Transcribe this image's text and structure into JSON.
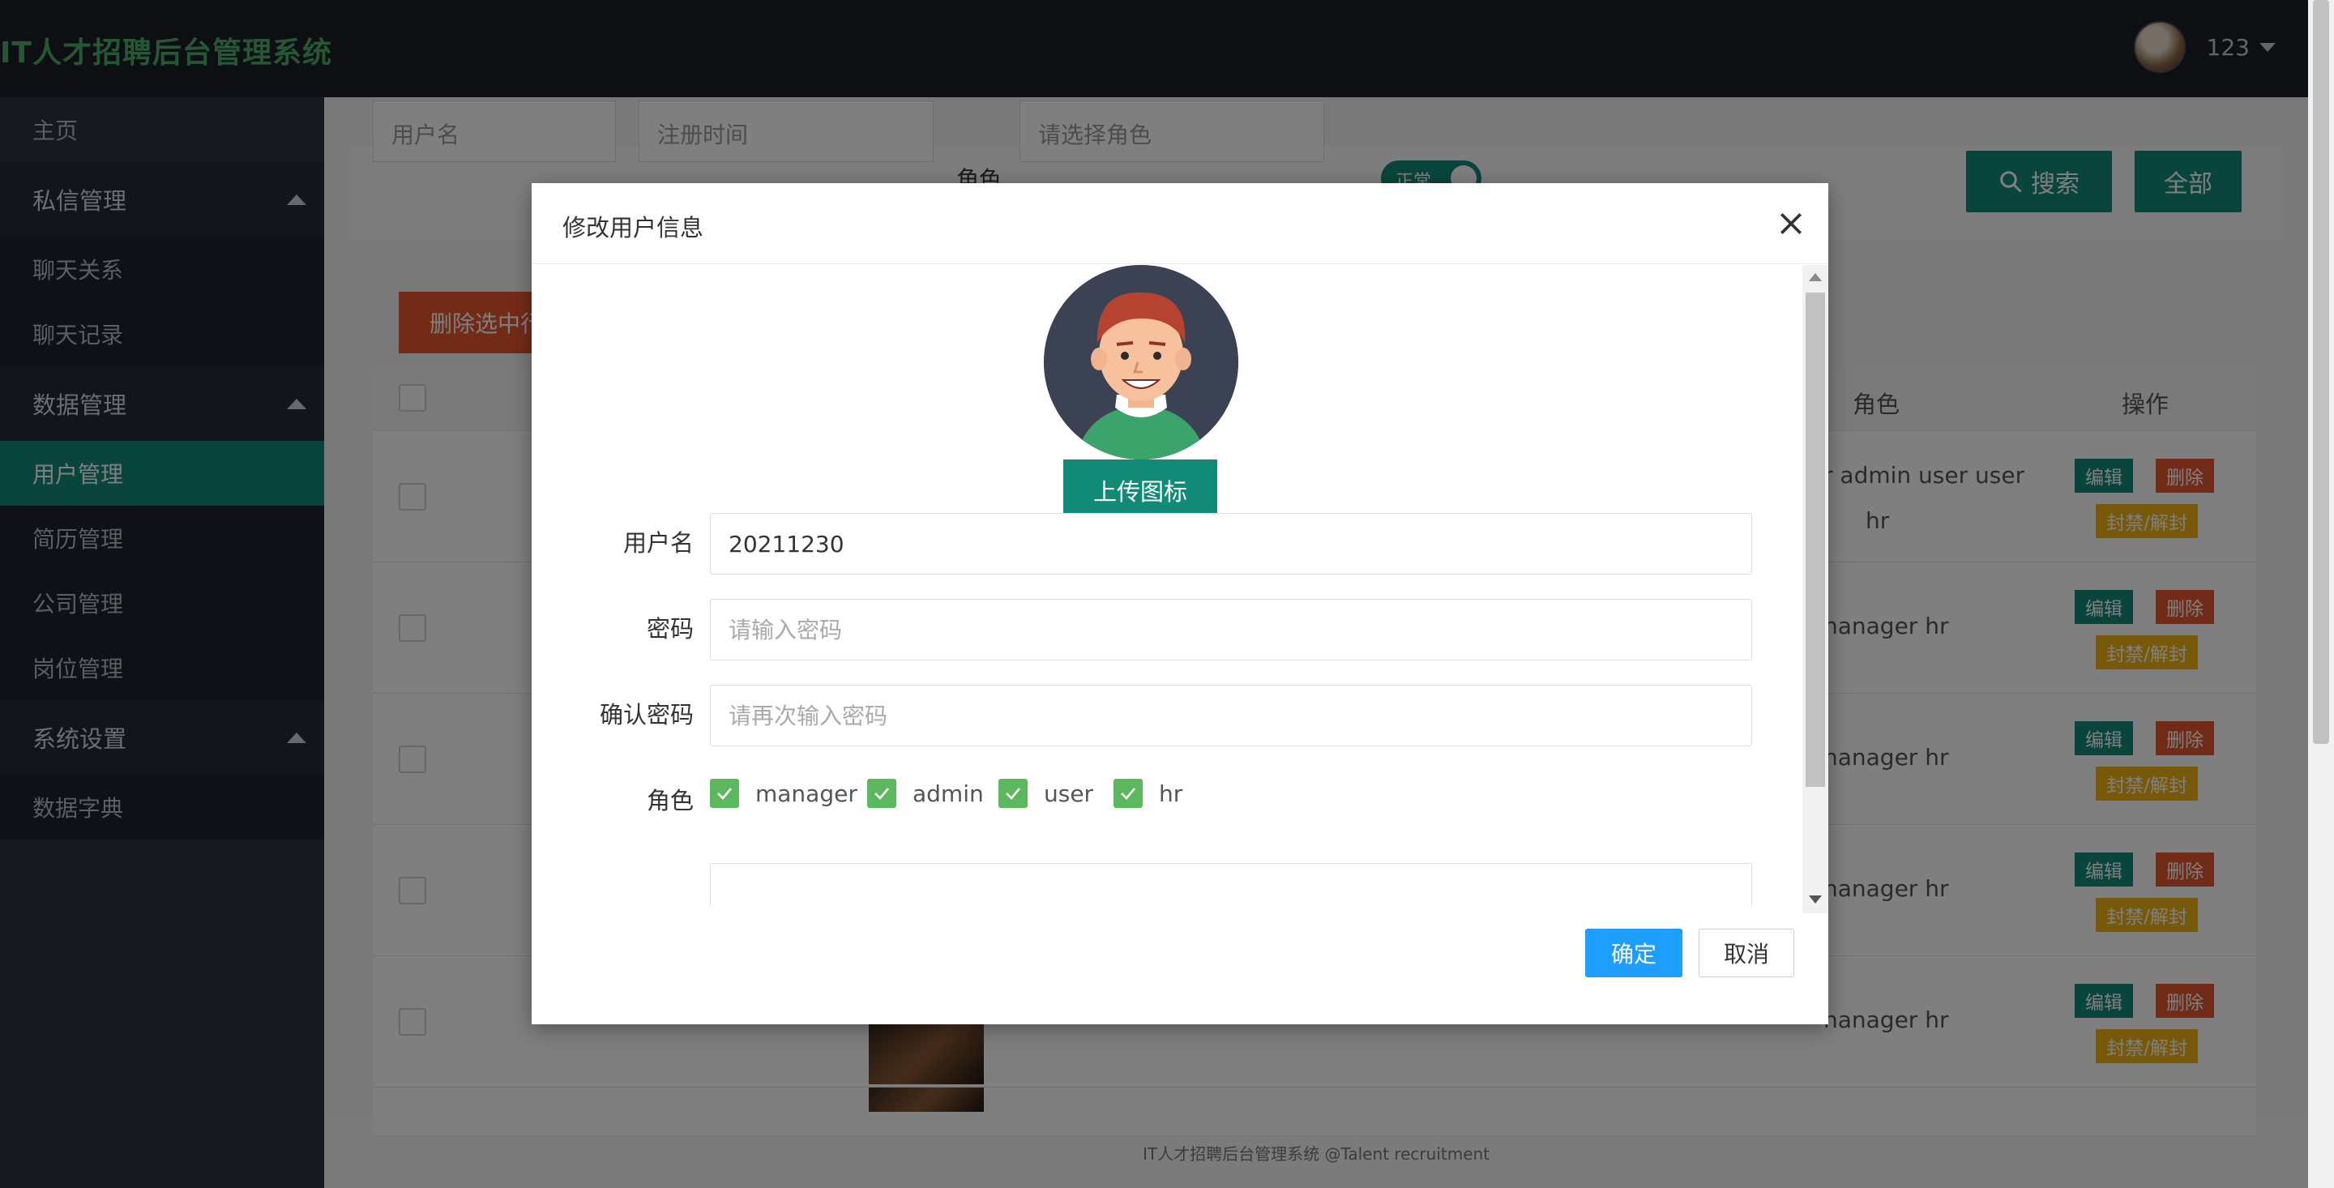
{
  "app": {
    "title": "IT人才招聘后台管理系统",
    "user": "123"
  },
  "sidebar": {
    "home": "主页",
    "groups": [
      {
        "label": "私信管理",
        "items": [
          "聊天关系",
          "聊天记录"
        ]
      },
      {
        "label": "数据管理",
        "items": [
          "用户管理",
          "简历管理",
          "公司管理",
          "岗位管理"
        ]
      },
      {
        "label": "系统设置",
        "items": [
          "数据字典"
        ]
      }
    ],
    "active": "用户管理"
  },
  "search": {
    "username_placeholder": "用户名",
    "regtime_placeholder": "注册时间",
    "role_label": "角色",
    "role_placeholder": "请选择角色",
    "status_toggle": "正常",
    "search_button": "搜索",
    "all_button": "全部"
  },
  "table": {
    "delete_selected": "删除选中行",
    "headers": {
      "role": "角色",
      "operation": "操作"
    },
    "rows": [
      {
        "roles_line1": "r admin user user",
        "roles_line2": "hr"
      },
      {
        "roles_line1": "nanager hr",
        "roles_line2": ""
      },
      {
        "roles_line1": "nanager hr",
        "roles_line2": ""
      },
      {
        "roles_line1": "nanager hr",
        "roles_line2": ""
      },
      {
        "roles_line1": "nanager hr",
        "roles_line2": ""
      }
    ],
    "ops": {
      "edit": "编辑",
      "delete": "删除",
      "ban": "封禁/解封"
    }
  },
  "footer": "IT人才招聘后台管理系统 @Talent recruitment",
  "modal": {
    "title": "修改用户信息",
    "upload_button": "上传图标",
    "fields": {
      "username_label": "用户名",
      "username_value": "20211230",
      "password_label": "密码",
      "password_placeholder": "请输入密码",
      "confirm_label": "确认密码",
      "confirm_placeholder": "请再次输入密码",
      "role_label": "角色"
    },
    "roles": [
      {
        "label": "manager",
        "checked": true
      },
      {
        "label": "admin",
        "checked": true
      },
      {
        "label": "user",
        "checked": true
      },
      {
        "label": "hr",
        "checked": true
      }
    ],
    "ok_button": "确定",
    "cancel_button": "取消"
  },
  "colors": {
    "header_bg": "#1b1f26",
    "sidebar_bg": "#2c3440",
    "accent_teal": "#128a78",
    "title_green": "#4caf6a",
    "danger": "#e4572e",
    "warning": "#f0b315",
    "primary_blue": "#1e9fff",
    "check_green": "#5cb85c"
  }
}
